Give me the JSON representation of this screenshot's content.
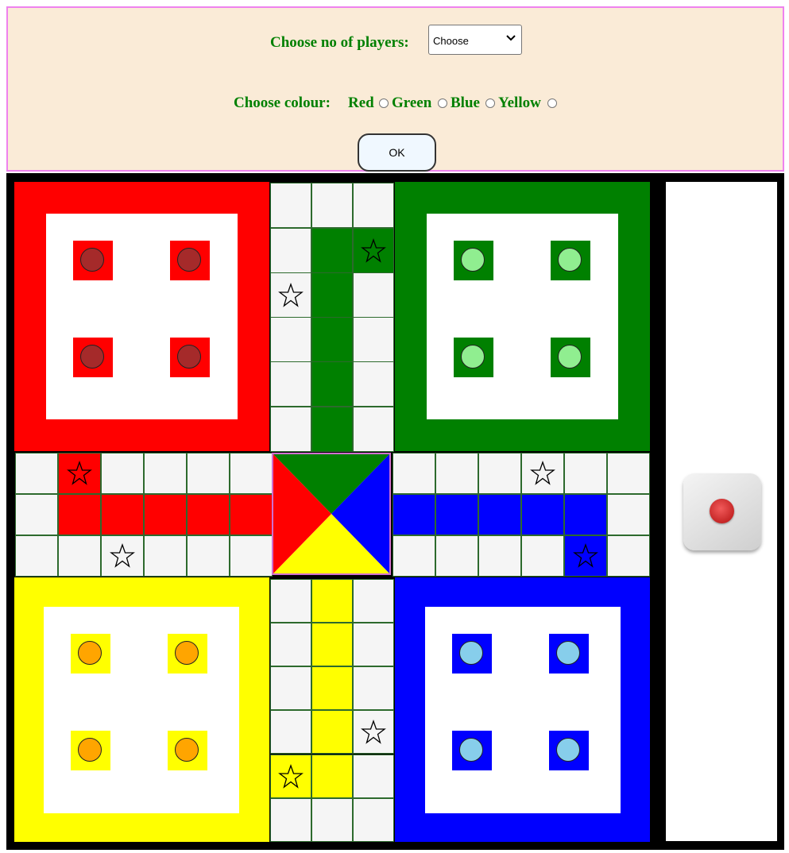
{
  "settings": {
    "players_label": "Choose no of players:",
    "players_select": {
      "value": "Choose",
      "icon": "chevron-down-icon"
    },
    "colour_label": "Choose colour:",
    "colour_options": [
      {
        "label": "Red",
        "selected": false
      },
      {
        "label": "Green",
        "selected": false
      },
      {
        "label": "Blue",
        "selected": false
      },
      {
        "label": "Yellow",
        "selected": false
      }
    ],
    "ok_button": "OK",
    "colors": {
      "background": "#faebd7",
      "border": "#ee82ee",
      "text": "#008000"
    }
  },
  "board": {
    "colors": {
      "red": "#ff0000",
      "green": "#008000",
      "blue": "#0000ff",
      "yellow": "#ffff00",
      "track": "#f5f5f5",
      "frame": "#000000"
    },
    "token_colors": {
      "red": "#a52a2a",
      "green": "#90ee90",
      "yellow": "#ffa500",
      "blue": "#87ceeb"
    },
    "tokens_per_player": 4,
    "safe_square_icon": "star-icon"
  },
  "dice": {
    "value": 1,
    "icon": "dice-icon"
  }
}
